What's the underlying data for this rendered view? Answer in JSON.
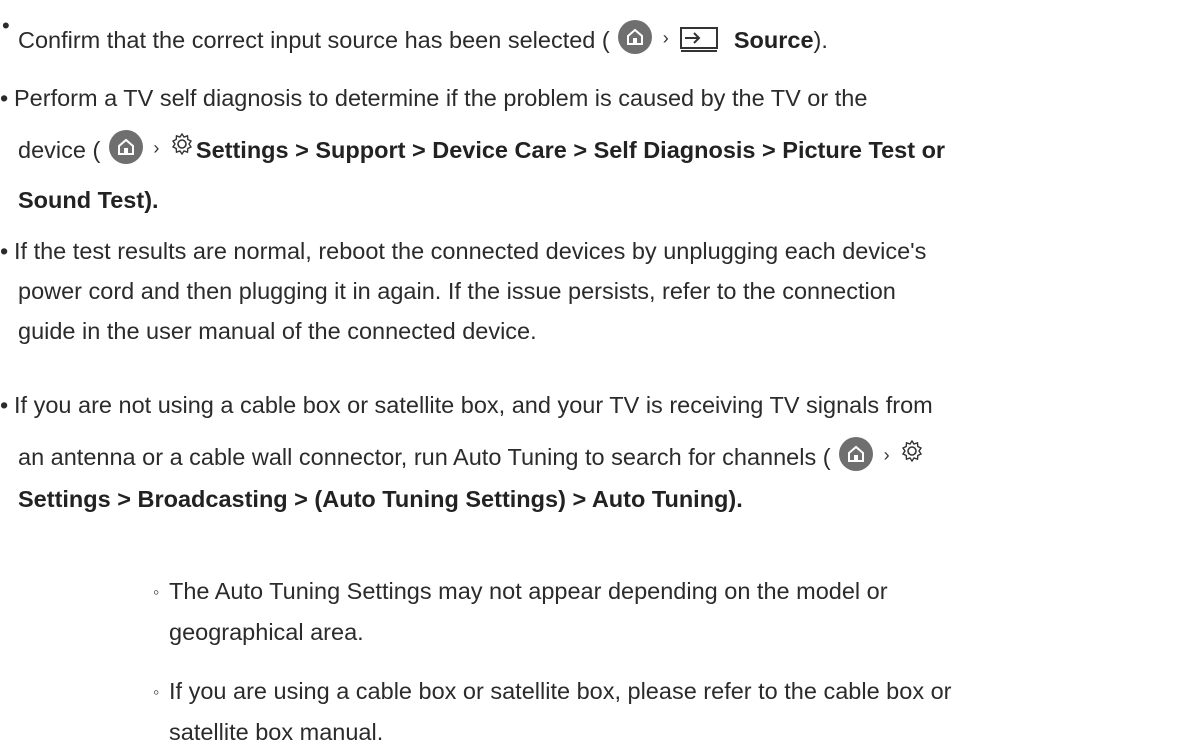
{
  "bullets": [
    {
      "marker": "•",
      "text_before": "Confirm that the correct input source has been selected (",
      "path_bold": "Source",
      "text_after": ")."
    },
    {
      "marker": "•",
      "line1": "Perform a TV self diagnosis to determine if the problem is caused by the TV or the",
      "line2_prefix": "device (",
      "path_bold_line2": "Settings > Support > Device Care > Self Diagnosis > Picture Test or",
      "path_bold_line3": "Sound Test)."
    },
    {
      "marker": "•",
      "line1": "If the test results are normal, reboot the connected devices by unplugging each device's",
      "line2": "power cord and then plugging it in again. If the issue persists, refer to the connection",
      "line3": "guide in the user manual of the connected device."
    },
    {
      "marker": "•",
      "line1": "If you are not using a cable box or satellite box, and your TV is receiving TV signals from",
      "line2_prefix": "an antenna or a cable wall connector, run Auto Tuning to search for channels (",
      "path_bold_line3": "Settings > Broadcasting > (Auto Tuning Settings) > Auto Tuning)."
    }
  ],
  "sub_bullets": [
    {
      "marker": "◦",
      "line1": "The Auto Tuning Settings may not appear depending on the model or",
      "line2": "geographical area."
    },
    {
      "marker": "◦",
      "line1": "If you are using a cable box or satellite box, please refer to the cable box or",
      "line2": "satellite box manual."
    }
  ],
  "icons": {
    "home": "home-icon",
    "source": "source-icon",
    "settings": "gear-icon",
    "chevron": "›"
  },
  "colors": {
    "text": "#2b2b2b",
    "icon_circle": "#6f6f6f"
  }
}
